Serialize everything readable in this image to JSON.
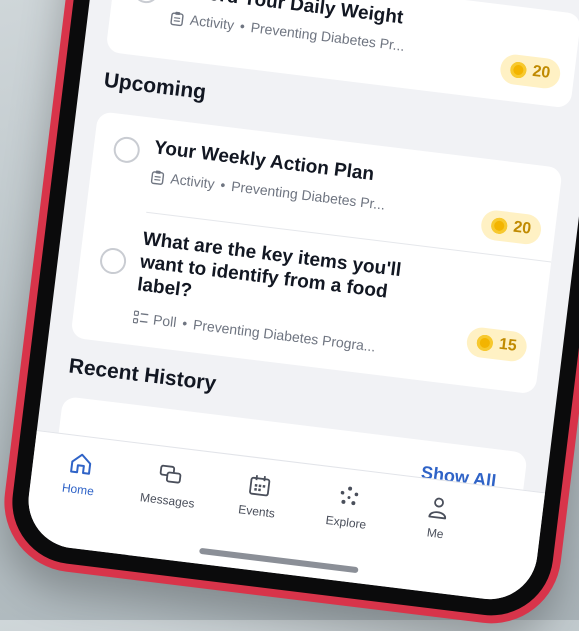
{
  "items_done": [
    {
      "title": "Record Your Daily Weight",
      "type": "Activity",
      "program": "Preventing Diabetes Pr...",
      "points": "20"
    }
  ],
  "upcoming": {
    "heading": "Upcoming",
    "items": [
      {
        "title": "Your Weekly Action Plan",
        "type": "Activity",
        "program": "Preventing Diabetes Pr...",
        "points": "20"
      },
      {
        "title": "What are the key items you'll want to identify from a food label?",
        "type": "Poll",
        "program": "Preventing Diabetes Progra...",
        "points": "15"
      }
    ]
  },
  "recent": {
    "heading": "Recent History",
    "show_all": "Show All"
  },
  "tabs": [
    {
      "label": "Home",
      "icon": "home-icon",
      "active": true
    },
    {
      "label": "Messages",
      "icon": "messages-icon"
    },
    {
      "label": "Events",
      "icon": "calendar-icon"
    },
    {
      "label": "Explore",
      "icon": "explore-icon"
    },
    {
      "label": "Me",
      "icon": "person-icon"
    }
  ],
  "colors": {
    "accent": "#2f63c7",
    "badge_bg": "#fff1c4",
    "coin": "#f3b400",
    "bezel": "#d8344a"
  },
  "separator": "•"
}
